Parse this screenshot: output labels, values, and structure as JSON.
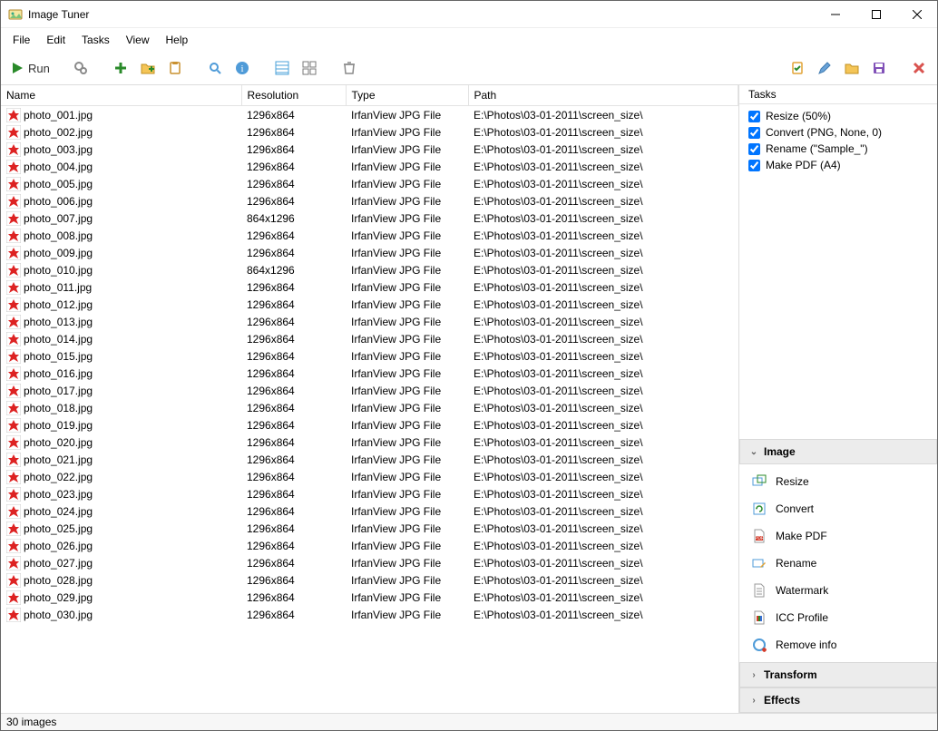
{
  "window": {
    "title": "Image Tuner"
  },
  "menu": [
    "File",
    "Edit",
    "Tasks",
    "View",
    "Help"
  ],
  "toolbar": {
    "run_label": "Run"
  },
  "columns": {
    "name": "Name",
    "resolution": "Resolution",
    "type": "Type",
    "path": "Path"
  },
  "files": [
    {
      "name": "photo_001.jpg",
      "resolution": "1296x864",
      "type": "IrfanView JPG File",
      "path": "E:\\Photos\\03-01-2011\\screen_size\\"
    },
    {
      "name": "photo_002.jpg",
      "resolution": "1296x864",
      "type": "IrfanView JPG File",
      "path": "E:\\Photos\\03-01-2011\\screen_size\\"
    },
    {
      "name": "photo_003.jpg",
      "resolution": "1296x864",
      "type": "IrfanView JPG File",
      "path": "E:\\Photos\\03-01-2011\\screen_size\\"
    },
    {
      "name": "photo_004.jpg",
      "resolution": "1296x864",
      "type": "IrfanView JPG File",
      "path": "E:\\Photos\\03-01-2011\\screen_size\\"
    },
    {
      "name": "photo_005.jpg",
      "resolution": "1296x864",
      "type": "IrfanView JPG File",
      "path": "E:\\Photos\\03-01-2011\\screen_size\\"
    },
    {
      "name": "photo_006.jpg",
      "resolution": "1296x864",
      "type": "IrfanView JPG File",
      "path": "E:\\Photos\\03-01-2011\\screen_size\\"
    },
    {
      "name": "photo_007.jpg",
      "resolution": "864x1296",
      "type": "IrfanView JPG File",
      "path": "E:\\Photos\\03-01-2011\\screen_size\\"
    },
    {
      "name": "photo_008.jpg",
      "resolution": "1296x864",
      "type": "IrfanView JPG File",
      "path": "E:\\Photos\\03-01-2011\\screen_size\\"
    },
    {
      "name": "photo_009.jpg",
      "resolution": "1296x864",
      "type": "IrfanView JPG File",
      "path": "E:\\Photos\\03-01-2011\\screen_size\\"
    },
    {
      "name": "photo_010.jpg",
      "resolution": "864x1296",
      "type": "IrfanView JPG File",
      "path": "E:\\Photos\\03-01-2011\\screen_size\\"
    },
    {
      "name": "photo_011.jpg",
      "resolution": "1296x864",
      "type": "IrfanView JPG File",
      "path": "E:\\Photos\\03-01-2011\\screen_size\\"
    },
    {
      "name": "photo_012.jpg",
      "resolution": "1296x864",
      "type": "IrfanView JPG File",
      "path": "E:\\Photos\\03-01-2011\\screen_size\\"
    },
    {
      "name": "photo_013.jpg",
      "resolution": "1296x864",
      "type": "IrfanView JPG File",
      "path": "E:\\Photos\\03-01-2011\\screen_size\\"
    },
    {
      "name": "photo_014.jpg",
      "resolution": "1296x864",
      "type": "IrfanView JPG File",
      "path": "E:\\Photos\\03-01-2011\\screen_size\\"
    },
    {
      "name": "photo_015.jpg",
      "resolution": "1296x864",
      "type": "IrfanView JPG File",
      "path": "E:\\Photos\\03-01-2011\\screen_size\\"
    },
    {
      "name": "photo_016.jpg",
      "resolution": "1296x864",
      "type": "IrfanView JPG File",
      "path": "E:\\Photos\\03-01-2011\\screen_size\\"
    },
    {
      "name": "photo_017.jpg",
      "resolution": "1296x864",
      "type": "IrfanView JPG File",
      "path": "E:\\Photos\\03-01-2011\\screen_size\\"
    },
    {
      "name": "photo_018.jpg",
      "resolution": "1296x864",
      "type": "IrfanView JPG File",
      "path": "E:\\Photos\\03-01-2011\\screen_size\\"
    },
    {
      "name": "photo_019.jpg",
      "resolution": "1296x864",
      "type": "IrfanView JPG File",
      "path": "E:\\Photos\\03-01-2011\\screen_size\\"
    },
    {
      "name": "photo_020.jpg",
      "resolution": "1296x864",
      "type": "IrfanView JPG File",
      "path": "E:\\Photos\\03-01-2011\\screen_size\\"
    },
    {
      "name": "photo_021.jpg",
      "resolution": "1296x864",
      "type": "IrfanView JPG File",
      "path": "E:\\Photos\\03-01-2011\\screen_size\\"
    },
    {
      "name": "photo_022.jpg",
      "resolution": "1296x864",
      "type": "IrfanView JPG File",
      "path": "E:\\Photos\\03-01-2011\\screen_size\\"
    },
    {
      "name": "photo_023.jpg",
      "resolution": "1296x864",
      "type": "IrfanView JPG File",
      "path": "E:\\Photos\\03-01-2011\\screen_size\\"
    },
    {
      "name": "photo_024.jpg",
      "resolution": "1296x864",
      "type": "IrfanView JPG File",
      "path": "E:\\Photos\\03-01-2011\\screen_size\\"
    },
    {
      "name": "photo_025.jpg",
      "resolution": "1296x864",
      "type": "IrfanView JPG File",
      "path": "E:\\Photos\\03-01-2011\\screen_size\\"
    },
    {
      "name": "photo_026.jpg",
      "resolution": "1296x864",
      "type": "IrfanView JPG File",
      "path": "E:\\Photos\\03-01-2011\\screen_size\\"
    },
    {
      "name": "photo_027.jpg",
      "resolution": "1296x864",
      "type": "IrfanView JPG File",
      "path": "E:\\Photos\\03-01-2011\\screen_size\\"
    },
    {
      "name": "photo_028.jpg",
      "resolution": "1296x864",
      "type": "IrfanView JPG File",
      "path": "E:\\Photos\\03-01-2011\\screen_size\\"
    },
    {
      "name": "photo_029.jpg",
      "resolution": "1296x864",
      "type": "IrfanView JPG File",
      "path": "E:\\Photos\\03-01-2011\\screen_size\\"
    },
    {
      "name": "photo_030.jpg",
      "resolution": "1296x864",
      "type": "IrfanView JPG File",
      "path": "E:\\Photos\\03-01-2011\\screen_size\\"
    }
  ],
  "sidebar": {
    "tasks_header": "Tasks",
    "tasks": [
      {
        "checked": true,
        "label": "Resize (50%)"
      },
      {
        "checked": true,
        "label": "Convert (PNG, None, 0)"
      },
      {
        "checked": true,
        "label": "Rename (\"Sample_\")"
      },
      {
        "checked": true,
        "label": "Make PDF (A4)"
      }
    ],
    "sections": [
      {
        "title": "Image",
        "expanded": true,
        "items": [
          {
            "icon": "resize-icon",
            "label": "Resize"
          },
          {
            "icon": "convert-icon",
            "label": "Convert"
          },
          {
            "icon": "pdf-icon",
            "label": "Make PDF"
          },
          {
            "icon": "rename-icon",
            "label": "Rename"
          },
          {
            "icon": "watermark-icon",
            "label": "Watermark"
          },
          {
            "icon": "icc-icon",
            "label": "ICC Profile"
          },
          {
            "icon": "removeinfo-icon",
            "label": "Remove info"
          }
        ]
      },
      {
        "title": "Transform",
        "expanded": false,
        "items": []
      },
      {
        "title": "Effects",
        "expanded": false,
        "items": []
      }
    ]
  },
  "status": {
    "text": "30 images"
  }
}
